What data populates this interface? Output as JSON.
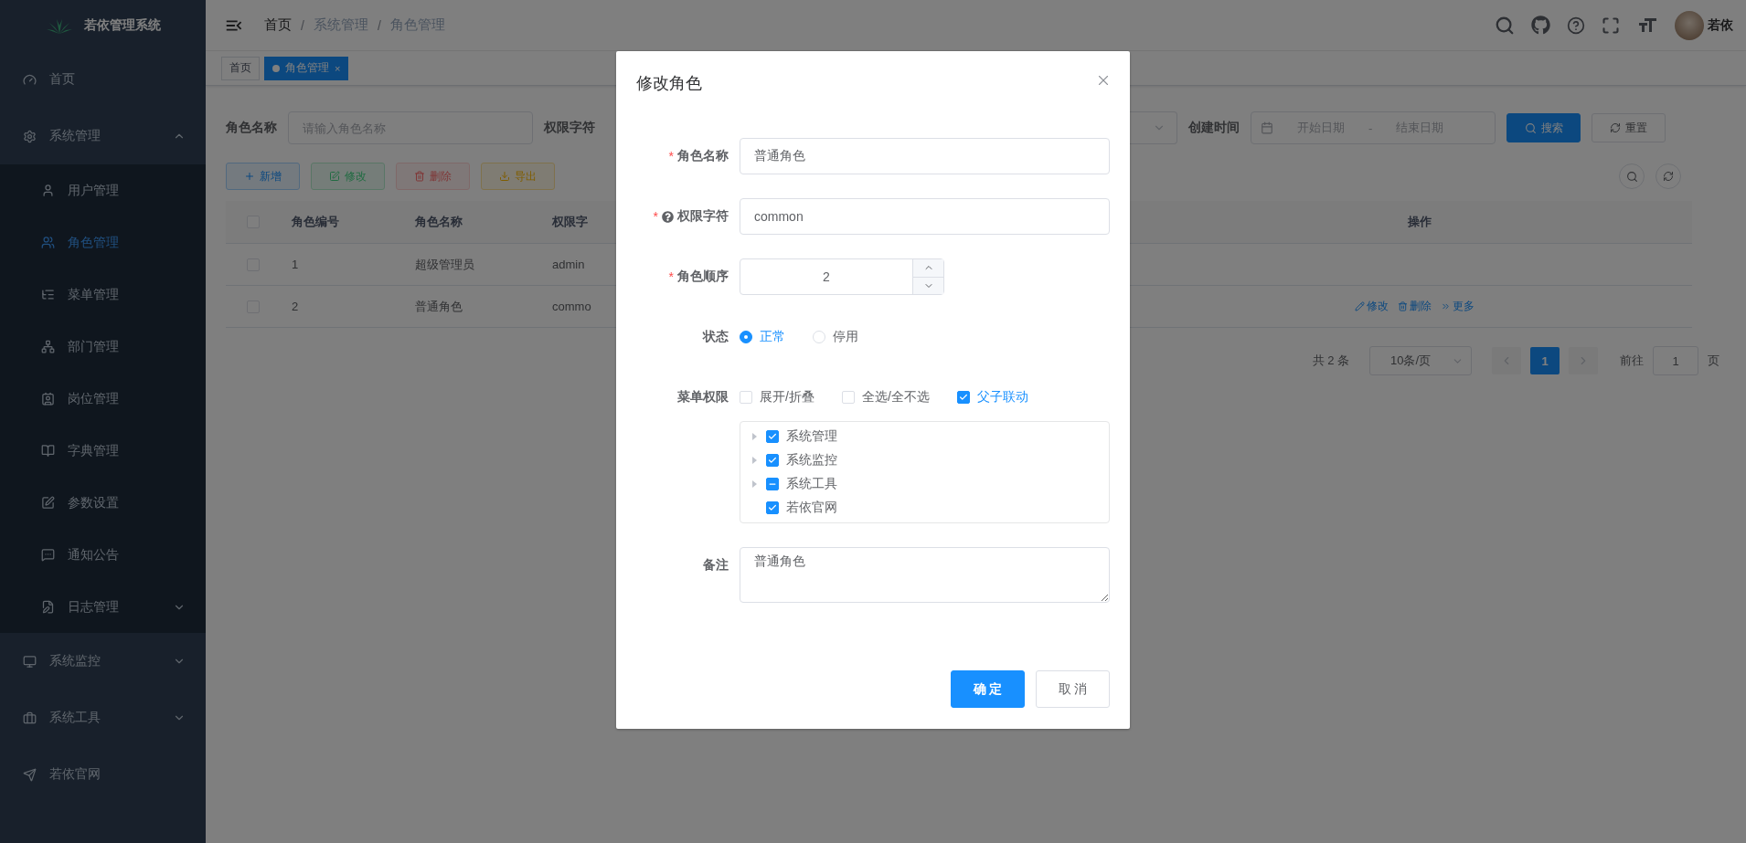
{
  "sidebar": {
    "logo": "若依管理系统",
    "items": [
      {
        "label": "首页",
        "selected": false
      },
      {
        "label": "系统管理",
        "selected": false,
        "expanded": true,
        "children": [
          {
            "label": "用户管理",
            "selected": false
          },
          {
            "label": "角色管理",
            "selected": true
          },
          {
            "label": "菜单管理",
            "selected": false
          },
          {
            "label": "部门管理",
            "selected": false
          },
          {
            "label": "岗位管理",
            "selected": false
          },
          {
            "label": "字典管理",
            "selected": false
          },
          {
            "label": "参数设置",
            "selected": false
          },
          {
            "label": "通知公告",
            "selected": false
          },
          {
            "label": "日志管理",
            "selected": false,
            "expanded": false
          }
        ]
      },
      {
        "label": "系统监控",
        "selected": false,
        "expanded": false
      },
      {
        "label": "系统工具",
        "selected": false,
        "expanded": false
      },
      {
        "label": "若依官网",
        "selected": false
      }
    ]
  },
  "breadcrumb": {
    "separator": "/",
    "items": [
      "首页",
      "系统管理",
      "角色管理"
    ]
  },
  "user": {
    "name": "若依"
  },
  "tags": [
    {
      "label": "首页",
      "selected": false
    },
    {
      "label": "角色管理",
      "selected": true,
      "close": "×"
    }
  ],
  "search_form": {
    "role_name": {
      "label": "角色名称",
      "placeholder": "请输入角色名称"
    },
    "role_key": {
      "label": "权限字符"
    },
    "created": {
      "label": "创建时间",
      "start_placeholder": "开始日期",
      "separator": "-",
      "end_placeholder": "结束日期"
    },
    "buttons": [
      {
        "label": "搜索",
        "kind": "primary"
      },
      {
        "label": "重置",
        "kind": "default"
      }
    ]
  },
  "toolbar": {
    "buttons": [
      {
        "label": "新增",
        "kind": "primary",
        "disabled": false
      },
      {
        "label": "修改",
        "kind": "success",
        "disabled": true
      },
      {
        "label": "删除",
        "kind": "danger",
        "disabled": true
      },
      {
        "label": "导出",
        "kind": "warning",
        "disabled": false
      }
    ]
  },
  "table": {
    "all_checked": false,
    "columns": [
      "角色编号",
      "角色名称",
      "权限字",
      "操作"
    ],
    "rows": [
      {
        "checked": false,
        "cells": [
          "1",
          "超级管理员",
          "admin"
        ],
        "actions": []
      },
      {
        "checked": false,
        "cells": [
          "2",
          "普通角色",
          "commo"
        ],
        "actions": [
          "修改",
          "删除",
          "更多"
        ]
      }
    ]
  },
  "pagination": {
    "total": "共 2 条",
    "page_size": "10条/页",
    "pages": [
      {
        "label": "1",
        "selected": true
      }
    ],
    "goto_label": "前往",
    "goto_value": "1",
    "goto_suffix": "页"
  },
  "dialog": {
    "title": "修改角色",
    "required_mark": "*",
    "fields": [
      {
        "kind": "text",
        "label": "角色名称",
        "required": true,
        "value": "普通角色"
      },
      {
        "kind": "text",
        "label": "权限字符",
        "required": true,
        "help": true,
        "value": "common"
      },
      {
        "kind": "number",
        "label": "角色顺序",
        "required": true,
        "value": "2"
      },
      {
        "kind": "radio",
        "label": "状态",
        "options": [
          {
            "label": "正常",
            "selected": true
          },
          {
            "label": "停用",
            "selected": false
          }
        ]
      },
      {
        "kind": "tree",
        "label": "菜单权限",
        "options": [
          {
            "label": "展开/折叠",
            "checked": false
          },
          {
            "label": "全选/全不选",
            "checked": false
          },
          {
            "label": "父子联动",
            "checked": true
          }
        ],
        "nodes": [
          {
            "label": "系统管理",
            "checked": true,
            "leaf": false
          },
          {
            "label": "系统监控",
            "checked": true,
            "leaf": false
          },
          {
            "label": "系统工具",
            "checked": false,
            "indeterminate": true,
            "leaf": false
          },
          {
            "label": "若依官网",
            "checked": true,
            "leaf": true
          }
        ]
      },
      {
        "kind": "textarea",
        "label": "备注",
        "value": "普通角色"
      }
    ],
    "buttons": [
      {
        "label": "确 定",
        "kind": "primary"
      },
      {
        "label": "取 消",
        "kind": "default"
      }
    ]
  }
}
